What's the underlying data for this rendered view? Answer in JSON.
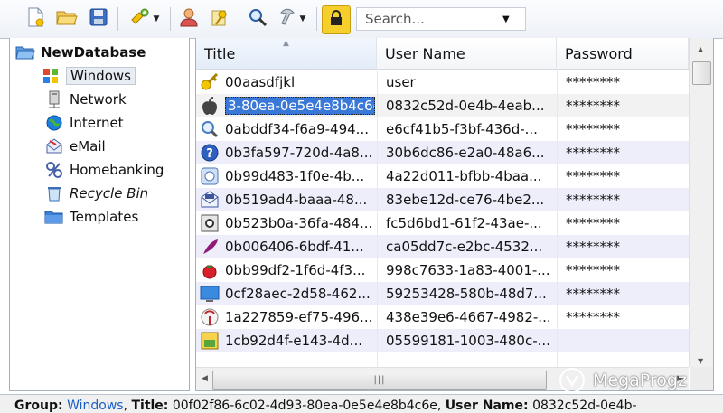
{
  "toolbar": {
    "buttons": [
      {
        "name": "new-database-icon"
      },
      {
        "name": "open-database-icon"
      },
      {
        "name": "save-database-icon"
      },
      {
        "name": "add-entry-icon"
      },
      {
        "name": "copy-username-icon"
      },
      {
        "name": "copy-password-icon"
      },
      {
        "name": "find-icon"
      },
      {
        "name": "tools-icon"
      },
      {
        "name": "lock-workspace-icon"
      }
    ],
    "search_placeholder": "Search..."
  },
  "groups": {
    "root": "NewDatabase",
    "items": [
      {
        "label": "Windows",
        "icon": "windows-icon",
        "selected": true
      },
      {
        "label": "Network",
        "icon": "network-icon"
      },
      {
        "label": "Internet",
        "icon": "internet-globe-icon"
      },
      {
        "label": "eMail",
        "icon": "email-icon"
      },
      {
        "label": "Homebanking",
        "icon": "homebanking-icon"
      },
      {
        "label": "Recycle Bin",
        "icon": "recycle-bin-icon",
        "italic": true
      },
      {
        "label": "Templates",
        "icon": "folder-icon"
      }
    ]
  },
  "entries": {
    "columns": [
      "Title",
      "User Name",
      "Password"
    ],
    "rows": [
      {
        "title": "00aasdfjkl",
        "user": "user",
        "password": "********",
        "icon": "key-icon"
      },
      {
        "title": "3-80ea-0e5e4e8b4c6e",
        "user": "0832c52d-0e4b-4eab...",
        "password": "********",
        "icon": "apple-icon",
        "selected": true
      },
      {
        "title": "0abddf34-f6a9-494...",
        "user": "e6cf41b5-f3bf-436d-...",
        "password": "********",
        "icon": "search-magnifier-icon"
      },
      {
        "title": "0b3fa597-720d-4a8...",
        "user": "30b6dc86-e2a0-48a6...",
        "password": "********",
        "icon": "help-icon"
      },
      {
        "title": "0b99d483-1f0e-4b...",
        "user": "4a22d011-bfbb-4baa...",
        "password": "********",
        "icon": "disc-icon"
      },
      {
        "title": "0b519ad4-baaa-48...",
        "user": "83ebe12d-ce76-4be2...",
        "password": "********",
        "icon": "mail-envelope-icon"
      },
      {
        "title": "0b523b0a-36fa-484...",
        "user": "fc5d6bd1-61f2-43ae-...",
        "password": "********",
        "icon": "safe-icon"
      },
      {
        "title": "0b006406-6bdf-41...",
        "user": "ca05dd7c-e2bc-4532...",
        "password": "********",
        "icon": "feather-icon"
      },
      {
        "title": "0bb99df2-1f6d-4f3...",
        "user": "998c7633-1a83-4001-...",
        "password": "********",
        "icon": "tomato-icon"
      },
      {
        "title": "0cf28aec-2d58-462...",
        "user": "59253428-580b-48d7...",
        "password": "********",
        "icon": "monitor-icon"
      },
      {
        "title": "1a227859-ef75-496...",
        "user": "438e39e6-4667-4982-...",
        "password": "********",
        "icon": "antenna-icon"
      },
      {
        "title": "1cb92d4f-e143-4d...",
        "user": "05599181-1003-480c-...",
        "password": "",
        "icon": "image-icon"
      }
    ]
  },
  "status": {
    "group_label": "Group:",
    "group_value": "Windows",
    "title_label": "Title:",
    "title_value": "00f02f86-6c02-4d93-80ea-0e5e4e8b4c6e",
    "user_label": "User Name:",
    "user_value": "0832c52d-0e4b-"
  },
  "watermark": "MegaProgz"
}
